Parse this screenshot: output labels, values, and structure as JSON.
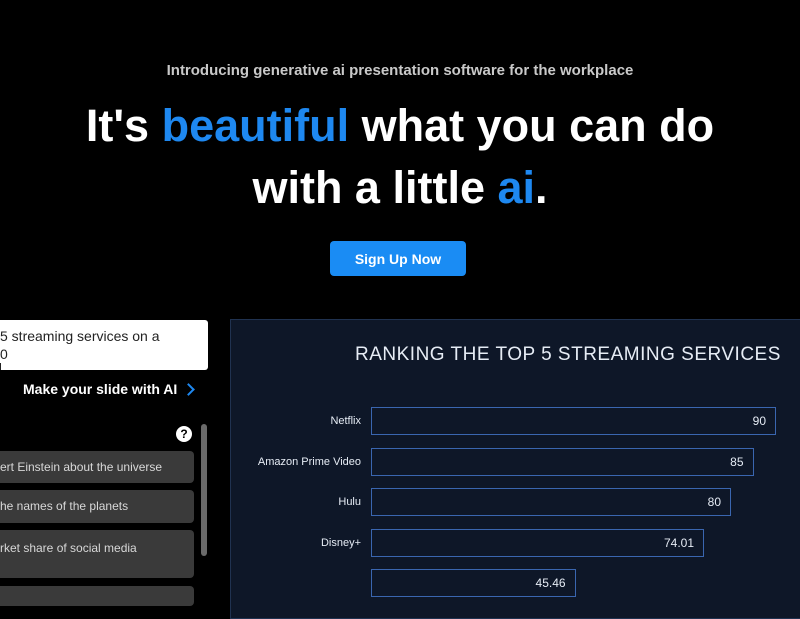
{
  "hero": {
    "eyebrow": "Introducing generative ai presentation software for the workplace",
    "headline_line1_a": "It's ",
    "headline_line1_accent": "beautiful",
    "headline_line1_b": " what you can do",
    "headline_line2_a": "with a little ",
    "headline_line2_accent": "ai",
    "headline_line2_b": ".",
    "accent_color": "#1e88f0",
    "cta_label": "Sign Up Now"
  },
  "prompt": {
    "line1": "5 streaming services on a",
    "line2": "0",
    "make_slide_label": "Make your slide with AI",
    "help_label": "?"
  },
  "suggestions": [
    "ert Einstein about the universe",
    "he names of the planets",
    "rket share of social media",
    ""
  ],
  "chart_data": {
    "type": "bar",
    "orientation": "horizontal",
    "title": "RANKING THE TOP 5 STREAMING SERVICES",
    "categories": [
      "Netflix",
      "Amazon Prime Video",
      "Hulu",
      "Disney+",
      ""
    ],
    "values": [
      90,
      85,
      80,
      74.01,
      45.46
    ],
    "value_labels": [
      "90",
      "85",
      "80",
      "74.01",
      "45.46"
    ],
    "xlim": [
      0,
      100
    ],
    "bar_outline_color": "#3a66b0"
  }
}
